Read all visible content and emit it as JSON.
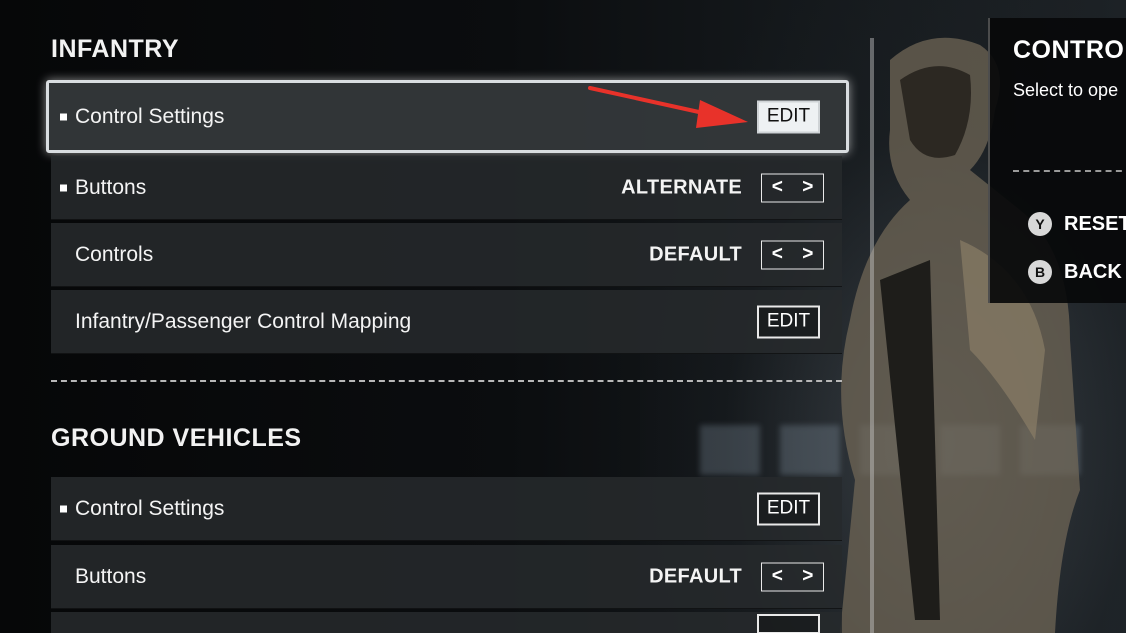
{
  "infantry": {
    "title": "INFANTRY",
    "rows": [
      {
        "label": "Control Settings",
        "button": "EDIT"
      },
      {
        "label": "Buttons",
        "value": "ALTERNATE"
      },
      {
        "label": "Controls",
        "value": "DEFAULT"
      },
      {
        "label": "Infantry/Passenger Control Mapping",
        "button": "EDIT"
      }
    ]
  },
  "ground_vehicles": {
    "title": "GROUND VEHICLES",
    "rows": [
      {
        "label": "Control Settings",
        "button": "EDIT"
      },
      {
        "label": "Buttons",
        "value": "DEFAULT"
      }
    ]
  },
  "arrows": {
    "left": "<",
    "right": ">"
  },
  "info_panel": {
    "title": "CONTROL",
    "description": "Select to ope",
    "hints": [
      {
        "glyph": "Y",
        "label": "RESET"
      },
      {
        "glyph": "B",
        "label": "BACK"
      }
    ]
  },
  "colors": {
    "annotation_arrow": "#e8322a",
    "selected_border": "#d9dde0",
    "row_background": "#262a2c"
  }
}
